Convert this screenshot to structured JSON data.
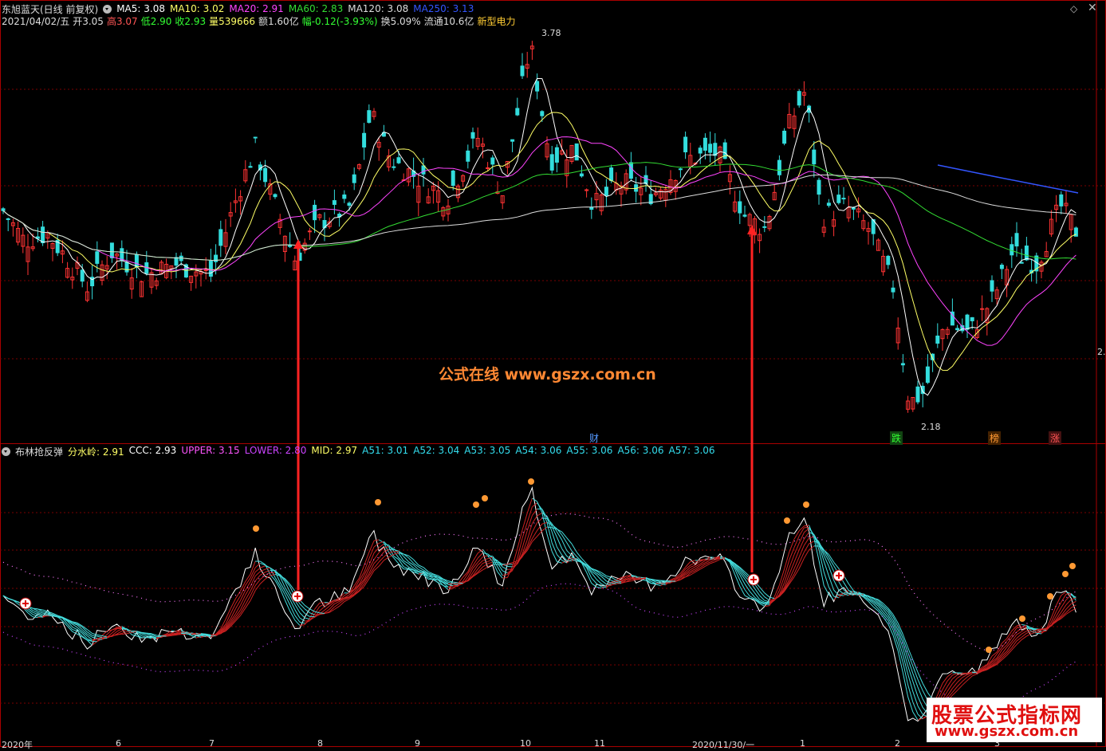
{
  "price_panel": {
    "stock_name": "东旭蓝天(日线 前复权)",
    "ma": [
      {
        "label": "MA5:",
        "value": "3.08",
        "color": "#ffffff"
      },
      {
        "label": "MA10:",
        "value": "3.02",
        "color": "#ffff66"
      },
      {
        "label": "MA20:",
        "value": "2.91",
        "color": "#ff44ff"
      },
      {
        "label": "MA60:",
        "value": "2.83",
        "color": "#33dd33"
      },
      {
        "label": "MA120:",
        "value": "3.08",
        "color": "#dddddd"
      },
      {
        "label": "MA250:",
        "value": "3.13",
        "color": "#3355ff"
      }
    ],
    "date": "2021/04/02/五",
    "open": "开3.05",
    "high": "高3.07",
    "low": "低2.90",
    "close": "收2.93",
    "volume": "量539666",
    "amount": "额1.60亿",
    "change": "幅-0.12(-3.93%)",
    "turnover": "换5.09%",
    "float_cap": "流通10.6亿",
    "sector": "新型电力",
    "high_label": "3.78",
    "low_label": "2.18",
    "right_edge_label": "2.",
    "markers": [
      {
        "text": "财",
        "color": "#5599ff"
      },
      {
        "text": "跌",
        "color": "#33ff33"
      },
      {
        "text": "榜",
        "color": "#ff9933"
      },
      {
        "text": "涨",
        "color": "#ff5555"
      }
    ],
    "watermark": "公式在线  www.gszx.com.cn"
  },
  "indicator_panel": {
    "name": "布林抢反弹",
    "values": [
      {
        "label": "分水岭:",
        "value": "2.91",
        "color": "#ffff66"
      },
      {
        "label": "CCC:",
        "value": "2.93",
        "color": "#ffffff"
      },
      {
        "label": "UPPER:",
        "value": "3.15",
        "color": "#ff55ff"
      },
      {
        "label": "LOWER:",
        "value": "2.80",
        "color": "#cc44ff"
      },
      {
        "label": "MID:",
        "value": "2.97",
        "color": "#ffff66"
      },
      {
        "label": "A51:",
        "value": "3.01",
        "color": "#33ddee"
      },
      {
        "label": "A52:",
        "value": "3.04",
        "color": "#33ddee"
      },
      {
        "label": "A53:",
        "value": "3.05",
        "color": "#33ddee"
      },
      {
        "label": "A54:",
        "value": "3.06",
        "color": "#33ddee"
      },
      {
        "label": "A55:",
        "value": "3.06",
        "color": "#33ddee"
      },
      {
        "label": "A56:",
        "value": "3.06",
        "color": "#33ddee"
      },
      {
        "label": "A57:",
        "value": "3.06",
        "color": "#33ddee"
      }
    ]
  },
  "x_axis": [
    "2020年",
    "6",
    "7",
    "8",
    "9",
    "10",
    "11",
    "2020/11/30/一",
    "1",
    "2",
    "3"
  ],
  "branding": {
    "cn": "股票公式指标网",
    "url": "www.gszx.com.cn"
  },
  "colors": {
    "up": "#ff3333",
    "down": "#33dddd",
    "arrow": "#ff2222",
    "grid": "#7a0000"
  }
}
